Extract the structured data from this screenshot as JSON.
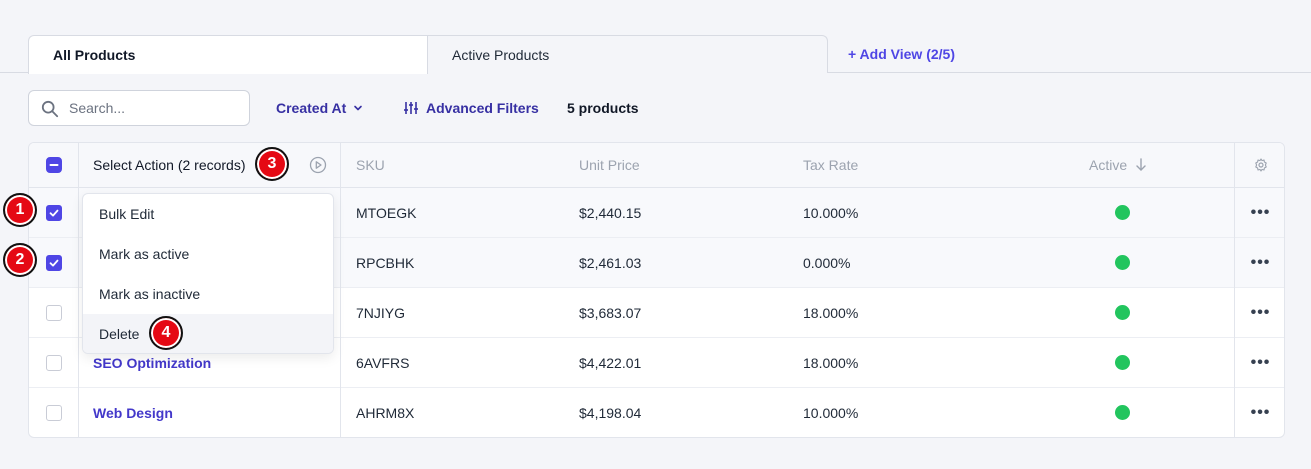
{
  "tabs": [
    {
      "label": "All Products",
      "active": true
    },
    {
      "label": "Active Products",
      "active": false
    }
  ],
  "add_view_label": "+ Add View (2/5)",
  "toolbar": {
    "search_placeholder": "Search...",
    "created_at_label": "Created At",
    "advanced_filters_label": "Advanced Filters",
    "count_label": "5 products"
  },
  "table": {
    "select_action_label": "Select Action (2 records)",
    "columns": [
      "SKU",
      "Unit Price",
      "Tax Rate",
      "Active"
    ],
    "rows": [
      {
        "name": "",
        "sku": "MTOEGK",
        "price": "$2,440.15",
        "tax": "10.000%",
        "checked": true,
        "active": true
      },
      {
        "name": "",
        "sku": "RPCBHK",
        "price": "$2,461.03",
        "tax": "0.000%",
        "checked": true,
        "active": true
      },
      {
        "name": "",
        "sku": "7NJIYG",
        "price": "$3,683.07",
        "tax": "18.000%",
        "checked": false,
        "active": true
      },
      {
        "name": "SEO Optimization",
        "sku": "6AVFRS",
        "price": "$4,422.01",
        "tax": "18.000%",
        "checked": false,
        "active": true
      },
      {
        "name": "Web Design",
        "sku": "AHRM8X",
        "price": "$4,198.04",
        "tax": "10.000%",
        "checked": false,
        "active": true
      }
    ]
  },
  "dropdown": {
    "items": [
      "Bulk Edit",
      "Mark as active",
      "Mark as inactive",
      "Delete"
    ]
  },
  "markers": [
    "1",
    "2",
    "3",
    "4"
  ],
  "colors": {
    "accent": "#4f46e5",
    "link": "#4338ca",
    "active_dot": "#22c55e",
    "marker": "#e50914"
  }
}
